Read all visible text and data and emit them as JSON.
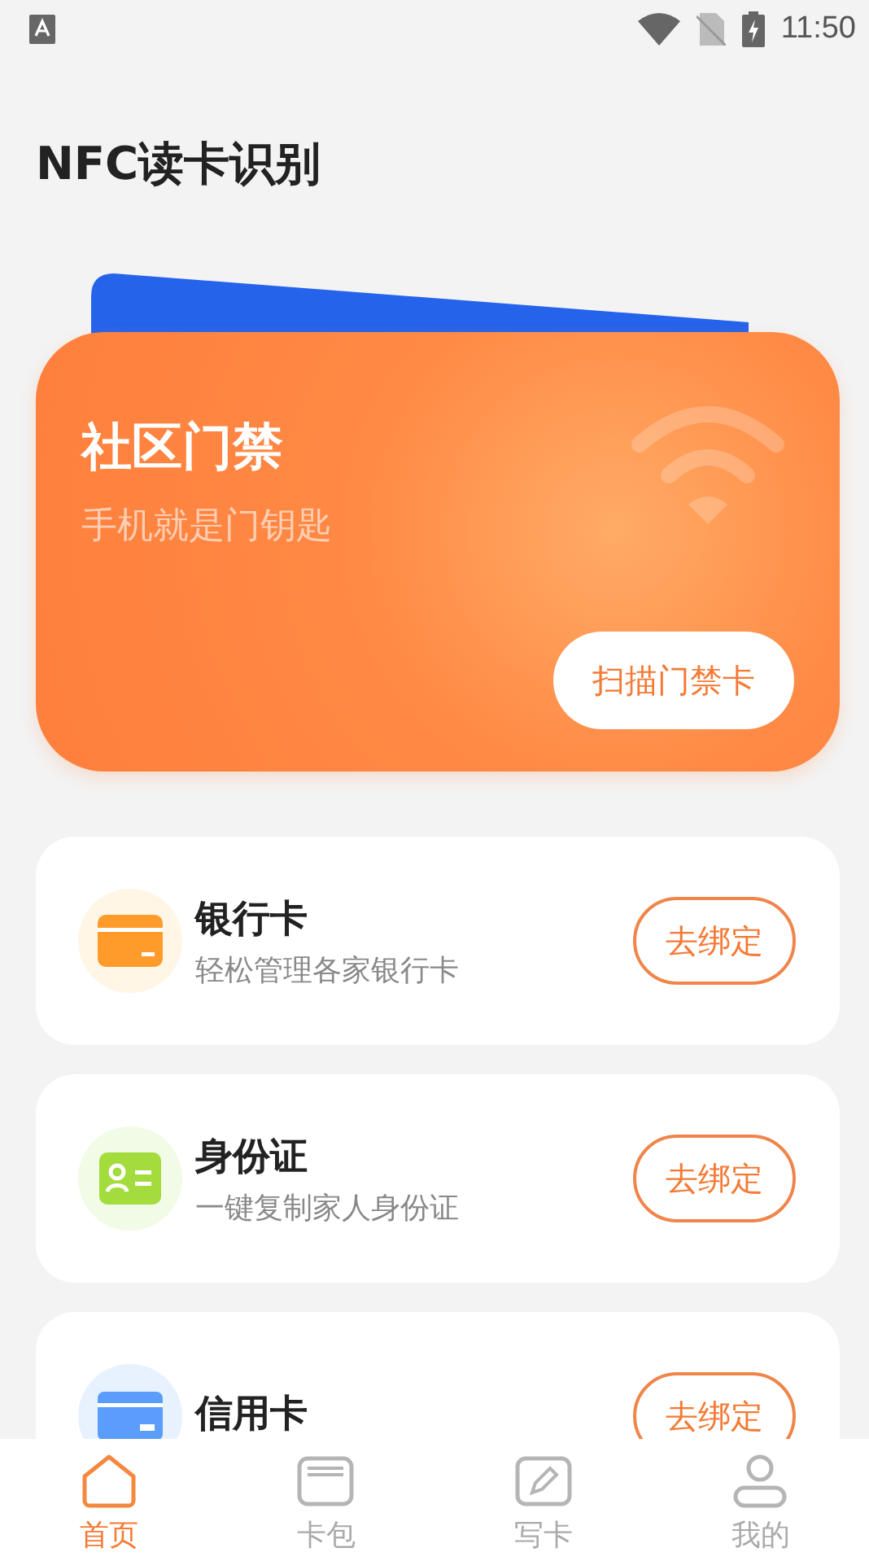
{
  "status_bar": {
    "time": "11:50"
  },
  "header": {
    "title": "NFC读卡识别"
  },
  "hero_card": {
    "title": "社区门禁",
    "subtitle": "手机就是门钥匙",
    "button": "扫描门禁卡"
  },
  "cards": [
    {
      "kind": "bank",
      "color": "#ff9b2a",
      "title": "银行卡",
      "subtitle": "轻松管理各家银行卡",
      "button": "去绑定"
    },
    {
      "kind": "id",
      "color": "#a3dc3c",
      "title": "身份证",
      "subtitle": "一键复制家人身份证",
      "button": "去绑定"
    },
    {
      "kind": "credit",
      "color": "#5b9dfb",
      "title": "信用卡",
      "button": "去绑定"
    }
  ],
  "tab_bar": [
    {
      "kind": "home",
      "label": "首页",
      "selected": true
    },
    {
      "kind": "wallet",
      "label": "卡包",
      "selected": false
    },
    {
      "kind": "write",
      "label": "写卡",
      "selected": false
    },
    {
      "kind": "user",
      "label": "我的",
      "selected": false
    }
  ]
}
